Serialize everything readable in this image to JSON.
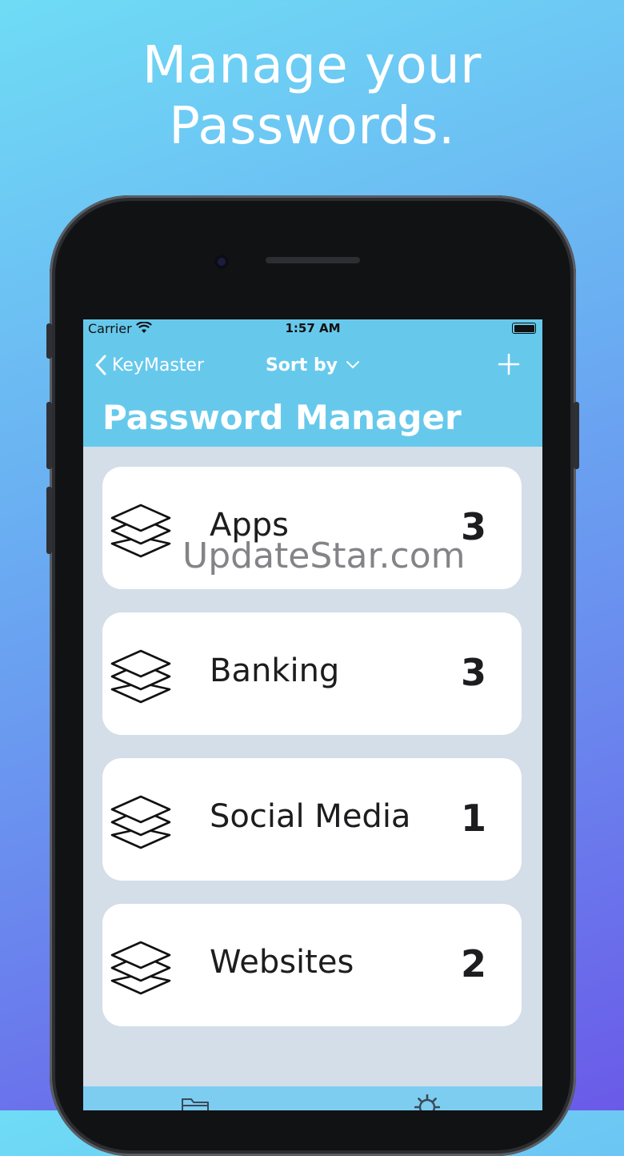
{
  "promo": {
    "line1": "Manage your",
    "line2": "Passwords."
  },
  "status_bar": {
    "carrier": "Carrier",
    "time": "1:57 AM"
  },
  "nav": {
    "back_label": "KeyMaster",
    "sort_label": "Sort by",
    "title": "Password Manager"
  },
  "categories": [
    {
      "name": "Apps",
      "count": "3"
    },
    {
      "name": "Banking",
      "count": "3"
    },
    {
      "name": "Social Media",
      "count": "1"
    },
    {
      "name": "Websites",
      "count": "2"
    }
  ],
  "watermark": "UpdateStar.com",
  "colors": {
    "nav_bar": "#66c9ec",
    "list_background": "#d3dee8",
    "card": "#ffffff"
  }
}
